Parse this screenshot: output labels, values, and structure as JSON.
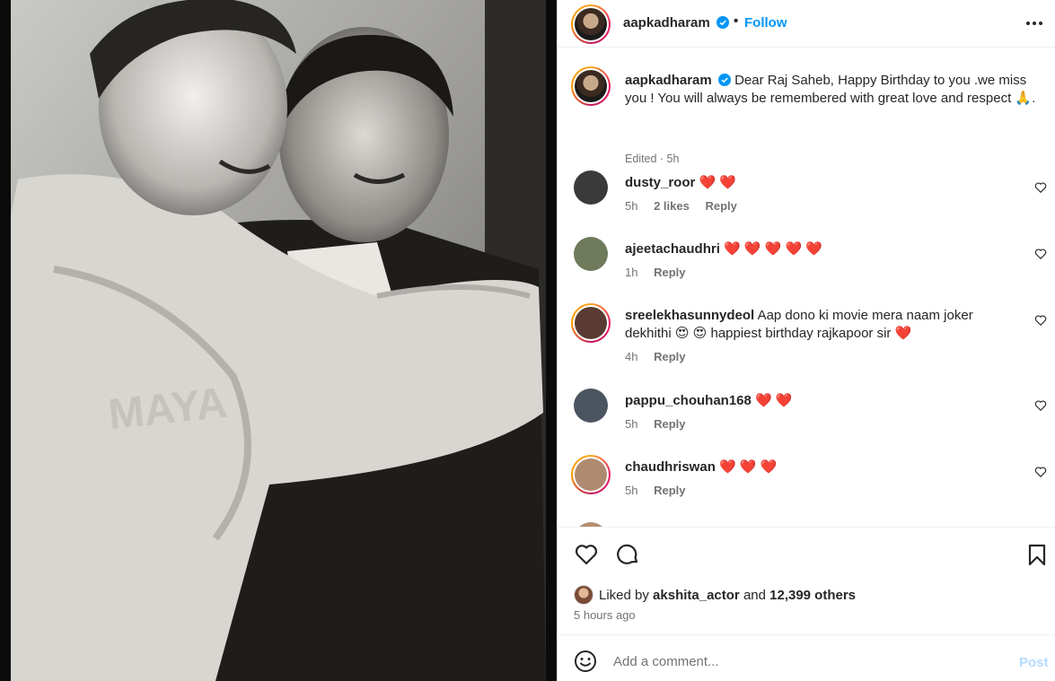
{
  "post": {
    "author": "aapkadharam",
    "follow_label": "Follow",
    "dot": "•"
  },
  "caption": {
    "username": "aapkadharam",
    "text": "Dear Raj Saheb, Happy Birthday to you .we miss you ! You will always be remembered with great love and respect 🙏.",
    "meta": "Edited · 5h"
  },
  "comments": [
    {
      "username": "dusty_roor",
      "text": "❤️ ❤️",
      "time": "5h",
      "likes": "2 likes",
      "reply": "Reply",
      "avatar_color": "#3a3a3a",
      "story_ring": false
    },
    {
      "username": "ajeetachaudhri",
      "text": "❤️ ❤️ ❤️ ❤️ ❤️",
      "time": "1h",
      "likes": "",
      "reply": "Reply",
      "avatar_color": "#6e7a5a",
      "story_ring": false
    },
    {
      "username": "sreelekhasunnydeol",
      "text": "Aap dono ki movie mera naam joker dekhithi 😍 😍 happiest birthday rajkapoor sir ❤️",
      "time": "4h",
      "likes": "",
      "reply": "Reply",
      "avatar_color": "#5a3b33",
      "story_ring": true
    },
    {
      "username": "pappu_chouhan168",
      "text": "❤️ ❤️",
      "time": "5h",
      "likes": "",
      "reply": "Reply",
      "avatar_color": "#4b5560",
      "story_ring": false
    },
    {
      "username": "chaudhriswan",
      "text": "❤️ ❤️ ❤️",
      "time": "5h",
      "likes": "",
      "reply": "Reply",
      "avatar_color": "#b08a70",
      "story_ring": true
    }
  ],
  "likes": {
    "prefix": "Liked by",
    "user": "akshita_actor",
    "middle": "and",
    "count": "12,399 others"
  },
  "time_ago": "5 hours ago",
  "composer": {
    "placeholder": "Add a comment...",
    "post_label": "Post"
  },
  "colors": {
    "accent": "#0095f6",
    "heart": "#e0142e",
    "muted": "#737373"
  }
}
